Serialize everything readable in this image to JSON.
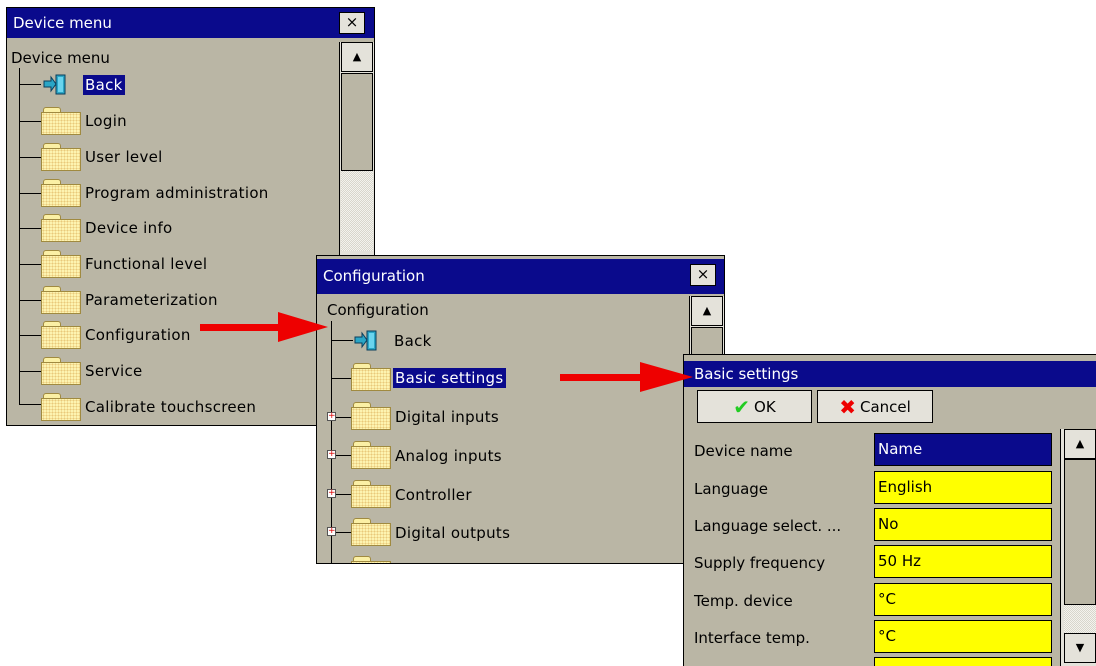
{
  "device_menu": {
    "title": "Device menu",
    "close": "×",
    "root": "Device menu",
    "back": "Back",
    "items": [
      "Login",
      "User level",
      "Program administration",
      "Device info",
      "Functional level",
      "Parameterization",
      "Configuration",
      "Service",
      "Calibrate touchscreen"
    ]
  },
  "configuration": {
    "title": "Configuration",
    "close": "×",
    "root": "Configuration",
    "back": "Back",
    "items": [
      "Basic settings",
      "Digital inputs",
      "Analog inputs",
      "Controller",
      "Digital outputs"
    ]
  },
  "basic_settings": {
    "title": "Basic settings",
    "ok": "OK",
    "cancel": "Cancel",
    "rows": [
      {
        "label": "Device name",
        "value": "Name"
      },
      {
        "label": "Language",
        "value": "English"
      },
      {
        "label": "Language select. ...",
        "value": "No"
      },
      {
        "label": "Supply frequency",
        "value": "50 Hz"
      },
      {
        "label": "Temp. device",
        "value": "°C"
      },
      {
        "label": "Interface temp.",
        "value": "°C"
      }
    ]
  },
  "colors": {
    "titlebar": "#0a0a8c",
    "window_bg": "#bab6a5",
    "field_bg": "#ffff00",
    "arrow": "#ee0000"
  }
}
